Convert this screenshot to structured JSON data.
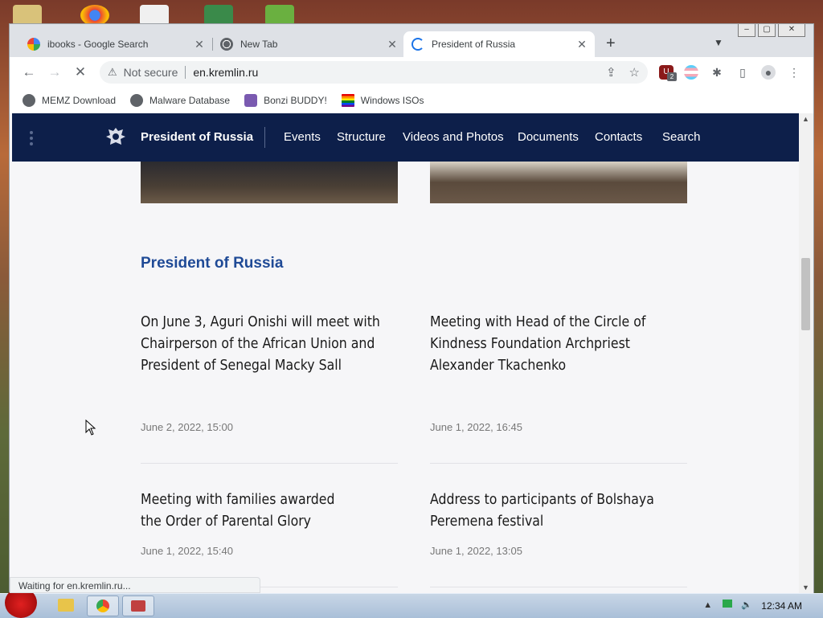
{
  "browser": {
    "tabs": [
      {
        "label": "ibooks - Google Search",
        "favicon": "google-icon",
        "active": false
      },
      {
        "label": "New Tab",
        "favicon": "chrome-icon",
        "active": false
      },
      {
        "label": "President of Russia",
        "favicon": "loading-spinner-icon",
        "active": true
      }
    ],
    "new_tab": "+",
    "omnibox": {
      "security": "Not secure",
      "url": "en.kremlin.ru"
    },
    "extension_badge": "2",
    "bookmarks": [
      {
        "label": "MEMZ Download",
        "icon": "globe-icon"
      },
      {
        "label": "Malware Database",
        "icon": "globe-icon"
      },
      {
        "label": "Bonzi BUDDY!",
        "icon": "bonzi-icon"
      },
      {
        "label": "Windows ISOs",
        "icon": "rainbow-flag-icon"
      }
    ],
    "status_text": "Waiting for en.kremlin.ru..."
  },
  "site": {
    "brand": "President of Russia",
    "nav": [
      "Events",
      "Structure",
      "Videos and Photos",
      "Documents",
      "Contacts",
      "Search"
    ],
    "section_title": "President of Russia",
    "news": [
      {
        "title": "On June 3, Aguri Onishi will meet with Chairperson of the African Union and President of Senegal Macky Sall",
        "date": "June 2, 2022, 15:00"
      },
      {
        "title": "Meeting with Head of the Circle of Kindness Foundation Archpriest Alexander Tkachenko",
        "date": "June 1, 2022, 16:45"
      },
      {
        "title": "Meeting with families awarded the Order of Parental Glory",
        "date": "June 1, 2022, 15:40"
      },
      {
        "title": "Address to participants of Bolshaya Peremena festival",
        "date": "June 1, 2022, 13:05"
      }
    ]
  },
  "taskbar": {
    "clock": "12:34 AM"
  },
  "colors": {
    "header_bg": "#0d1f4a",
    "section_title": "#1f4a96",
    "page_bg": "#f6f6f8"
  }
}
